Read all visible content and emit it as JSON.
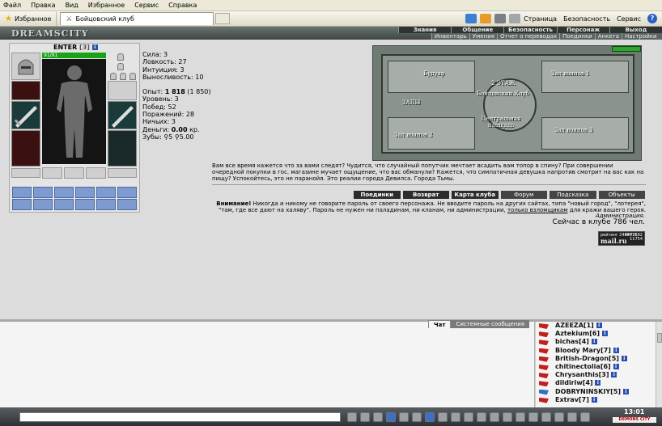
{
  "menubar": [
    "Файл",
    "Правка",
    "Вид",
    "Избранное",
    "Сервис",
    "Справка"
  ],
  "toolbar": {
    "favorites": "Избранное",
    "tab_title": "Бойцовский клуб",
    "page_menu": "Страница",
    "security_menu": "Безопасность",
    "service_menu": "Сервис"
  },
  "game": {
    "logo": "DREAMSCITY",
    "nav_top": [
      "Знания",
      "Общение",
      "Безопасность",
      "Персонаж",
      "Выход"
    ],
    "nav_sub": [
      "Инвентарь",
      "Умения",
      "Отчет о переводах",
      "Поединки",
      "Анкета",
      "Настройки"
    ]
  },
  "character": {
    "name": "ENTER",
    "level": "[3]",
    "hp": "91/91",
    "stats": [
      "Сила: 3",
      "Ловкость: 27",
      "Интуиция: 3",
      "Выносливость: 10"
    ],
    "experience_label": "Опыт:",
    "experience_value": "1 818",
    "experience_next": "(1 850)",
    "details": [
      "Уровень: 3",
      "Побед: 52",
      "Поражений: 28",
      "Ничьих: 3"
    ],
    "money_label": "Деньги:",
    "money_value": "0.00",
    "money_unit": "кр.",
    "teeth": "Зубы: ⚲5 ⚲5.00"
  },
  "map": {
    "labels": [
      "Будуар",
      "Зал воинов 1",
      "2 ЭТАЖ",
      "Бойцовский Клуб",
      "ЗАЛЫ",
      "Центральная площадь",
      "Зал воинов 2",
      "Зал воинов 3"
    ]
  },
  "intro_text": "Вам все время кажется что за вами следят? Чудится, что случайный попутчик мечтает всадить вам топор в спину? При совершении очередной покупки в гос. магазине мучает ощущение, что вас обманули? Кажется, что симпатичная девушка напротив смотрит на вас как на пищу? Успокойтесь, это не паранойя. Это реалии города Девилса. Города Тьмы.",
  "buttons": [
    "Поединки",
    "Возврат",
    "Карта клуба",
    "Форум",
    "Подсказка",
    "Объекты"
  ],
  "warning": {
    "bold": "Внимание!",
    "text": " Никогда и никому не говорите пароль от своего персонажа. Не вводите пароль на других сайтах, типа \"новый город\", \"лотерея\", \"там, где все дают на халяву\". Пароль не нужен ни паладинам, ни кланам, ни администрации, ",
    "underlined": "только взломщикам",
    "end": " для кражи вашего героя."
  },
  "admin_sign": "Администрация.",
  "online_text": "Сейчас в клубе 786 чел.",
  "counter": {
    "top": "рейтинг 2446476",
    "logo": "mail.ru",
    "num1": "3471692",
    "num2": "11754"
  },
  "chat": {
    "tab_chat": "Чат",
    "tab_system": "Системные сообщения"
  },
  "players": [
    {
      "name": "AZEEZA",
      "level": "[1]",
      "flag": "red"
    },
    {
      "name": "Aztekium",
      "level": "[6]",
      "flag": "red"
    },
    {
      "name": "bichas",
      "level": "[4]",
      "flag": "red"
    },
    {
      "name": "Bloody Mary",
      "level": "[7]",
      "flag": "red"
    },
    {
      "name": "British-Dragon",
      "level": "[5]",
      "flag": "red"
    },
    {
      "name": "chitinectolia",
      "level": "[6]",
      "flag": "red"
    },
    {
      "name": "Chrysanthis",
      "level": "[3]",
      "flag": "red"
    },
    {
      "name": "dildiriw",
      "level": "[4]",
      "flag": "red"
    },
    {
      "name": "DOBRYNINSKIY",
      "level": "[5]",
      "flag": "blue"
    },
    {
      "name": "Extrav",
      "level": "[7]",
      "flag": "red"
    }
  ],
  "clock": "13:01",
  "city": "DEMONS CITY"
}
